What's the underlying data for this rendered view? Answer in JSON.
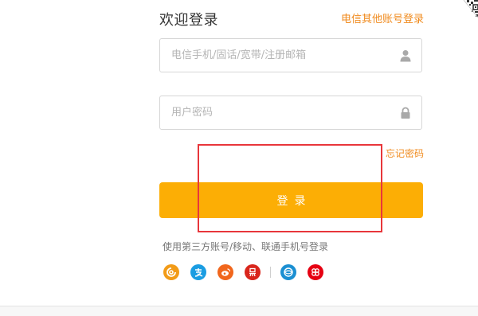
{
  "login": {
    "title": "欢迎登录",
    "other_account_link": "电信其他账号登录",
    "phone_placeholder": "电信手机/固话/宽带/注册邮箱",
    "password_placeholder": "用户密码",
    "forgot_password": "忘记密码",
    "login_button": "登录",
    "third_party_text": "使用第三方账号/移动、联通手机号登录"
  },
  "icons": {
    "qr_corner": "qr-code-icon",
    "user": "user-icon",
    "lock": "lock-icon",
    "social": [
      "tianyi-icon",
      "alipay-icon",
      "weibo-icon",
      "yixin-icon",
      "china-mobile-icon",
      "china-unicom-icon"
    ]
  },
  "colors": {
    "accent": "#f08a1c",
    "button": "#fcae05",
    "annotation_box": "#e8363b"
  }
}
